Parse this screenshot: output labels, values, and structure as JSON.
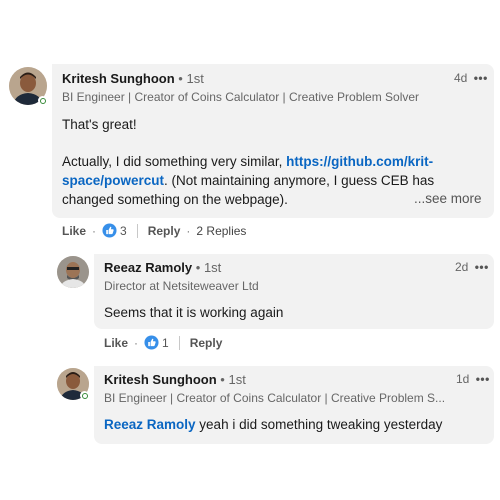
{
  "comment1": {
    "author": "Kritesh Sunghoon",
    "degree": "• 1st",
    "headline": "BI Engineer | Creator of Coins Calculator | Creative Problem Solver",
    "time": "4d",
    "body_line1": "That's great!",
    "body_pre_link": "Actually, I did something very similar, ",
    "link": "https://github.com/krit-space/powercut",
    "body_post_link": ". (Not maintaining anymore, I guess CEB has changed something on the webpage).",
    "see_more": "...see more",
    "like_label": "Like",
    "reaction_count": "3",
    "reply_label": "Reply",
    "replies_label": "2 Replies"
  },
  "reply1": {
    "author": "Reeaz Ramoly",
    "degree": "• 1st",
    "headline": "Director at Netsiteweaver Ltd",
    "time": "2d",
    "body": "Seems that it is working again",
    "like_label": "Like",
    "reaction_count": "1",
    "reply_label": "Reply"
  },
  "reply2": {
    "author": "Kritesh Sunghoon",
    "degree": "• 1st",
    "headline": "BI Engineer | Creator of Coins Calculator | Creative Problem S...",
    "time": "1d",
    "mention": "Reeaz Ramoly",
    "body": " yeah i did something tweaking yesterday"
  },
  "icons": {
    "more": "more-options-icon",
    "reaction": "like-reaction-icon",
    "online": "online-status-icon"
  },
  "colors": {
    "link": "#0a66c2",
    "bubble": "#f2f2f2",
    "online": "#378b39"
  }
}
